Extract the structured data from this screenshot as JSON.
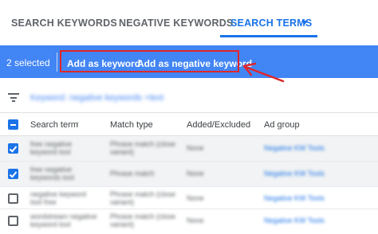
{
  "tabs": [
    {
      "label": "SEARCH KEYWORDS",
      "active": false
    },
    {
      "label": "NEGATIVE KEYWORDS",
      "active": false
    },
    {
      "label": "SEARCH TERMS",
      "active": true
    }
  ],
  "selection_bar": {
    "count_label": "2 selected",
    "actions": [
      "Add as keyword",
      "Add as negative keyword"
    ],
    "color": "#4285f4"
  },
  "annotation": {
    "color": "#e0262a"
  },
  "filter": {
    "text": "Keyword: negative keywords +text"
  },
  "table": {
    "columns": [
      "Search term",
      "Match type",
      "Added/Excluded",
      "Ad group"
    ],
    "rows": [
      {
        "checked": true,
        "term": [
          "free negative",
          "keyword tool"
        ],
        "match": [
          "Phrase match (close",
          "variant)"
        ],
        "added": "None",
        "ad_group": "Negative KW Tools"
      },
      {
        "checked": true,
        "term": [
          "free negative",
          "keywords tool"
        ],
        "match": [
          "Phrase match"
        ],
        "added": "None",
        "ad_group": "Negative KW Tools"
      },
      {
        "checked": false,
        "term": [
          "negative keyword",
          "tool free"
        ],
        "match": [
          "Phrase match (close",
          "variant)"
        ],
        "added": "None",
        "ad_group": "Negative KW Tools"
      },
      {
        "checked": false,
        "term": [
          "wordstream negative",
          "keyword tool"
        ],
        "match": [
          "Phrase match (close",
          "variant)"
        ],
        "added": "None",
        "ad_group": "Negative KW Tools"
      }
    ]
  }
}
